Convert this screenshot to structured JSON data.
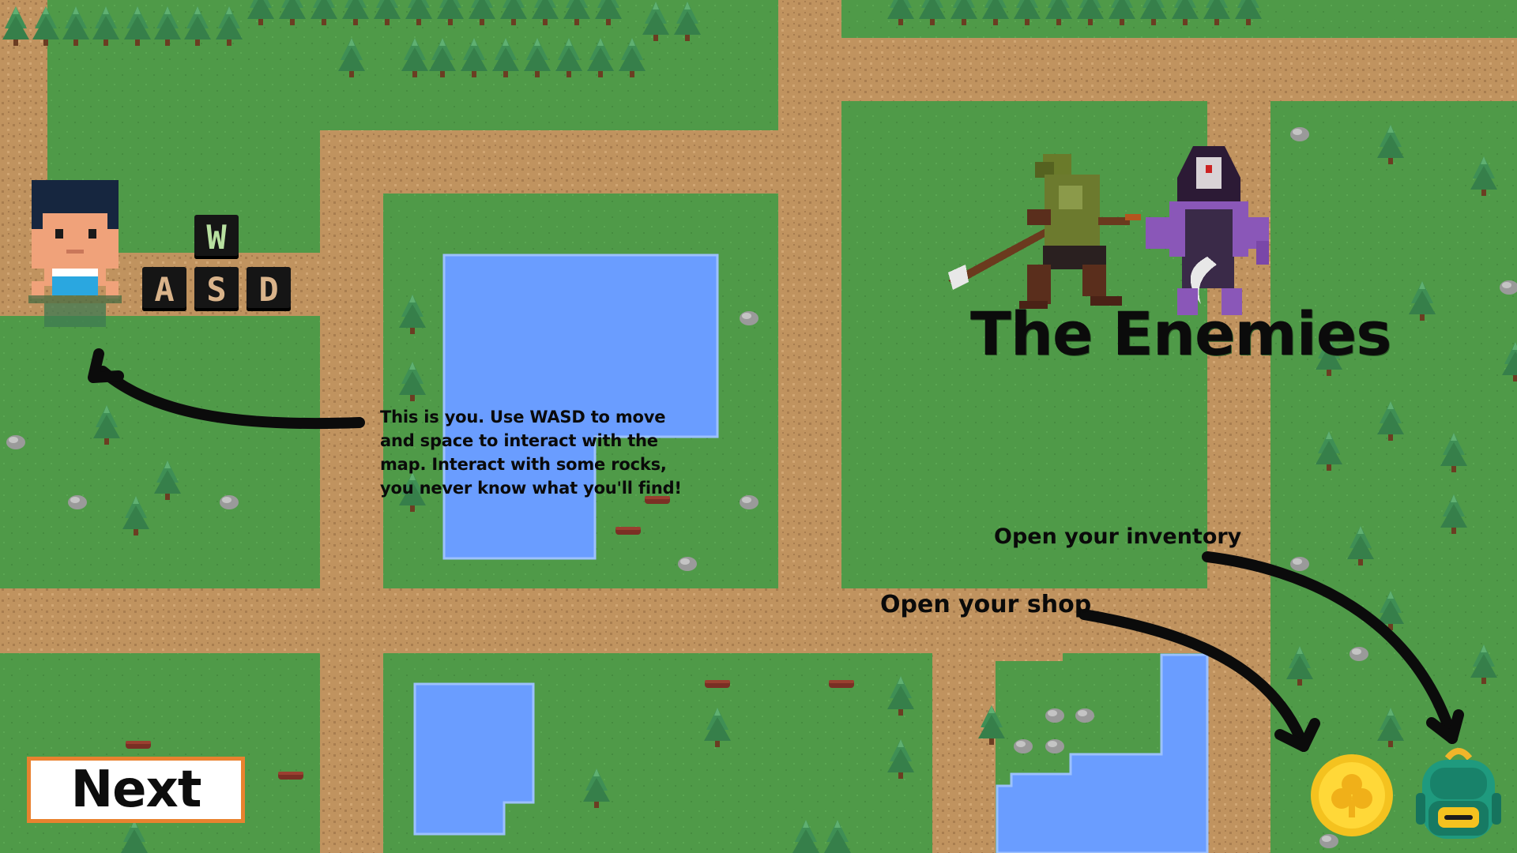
{
  "tutorial": {
    "text": "This is you. Use WASD to move and space to interact with the map. Interact with some rocks, you never know what you'll find!"
  },
  "keys": {
    "w": "W",
    "a": "A",
    "s": "S",
    "d": "D"
  },
  "enemies": {
    "title": "The Enemies"
  },
  "inventory_hint": {
    "text": "Open your inventory"
  },
  "shop_hint": {
    "text": "Open your shop"
  },
  "next_button": {
    "label": "Next"
  },
  "icons": {
    "player": "player-character-icon",
    "enemy_1": "goblin-spearman-icon",
    "enemy_2": "hooded-wraith-icon",
    "shop": "gold-coin-icon",
    "inventory": "backpack-icon"
  },
  "colors": {
    "grass": "#4f9a48",
    "path": "#c0935f",
    "water": "#6a9dff",
    "next_border": "#e9822f",
    "coin": "#f4c21f",
    "backpack": "#1f9a7e"
  }
}
